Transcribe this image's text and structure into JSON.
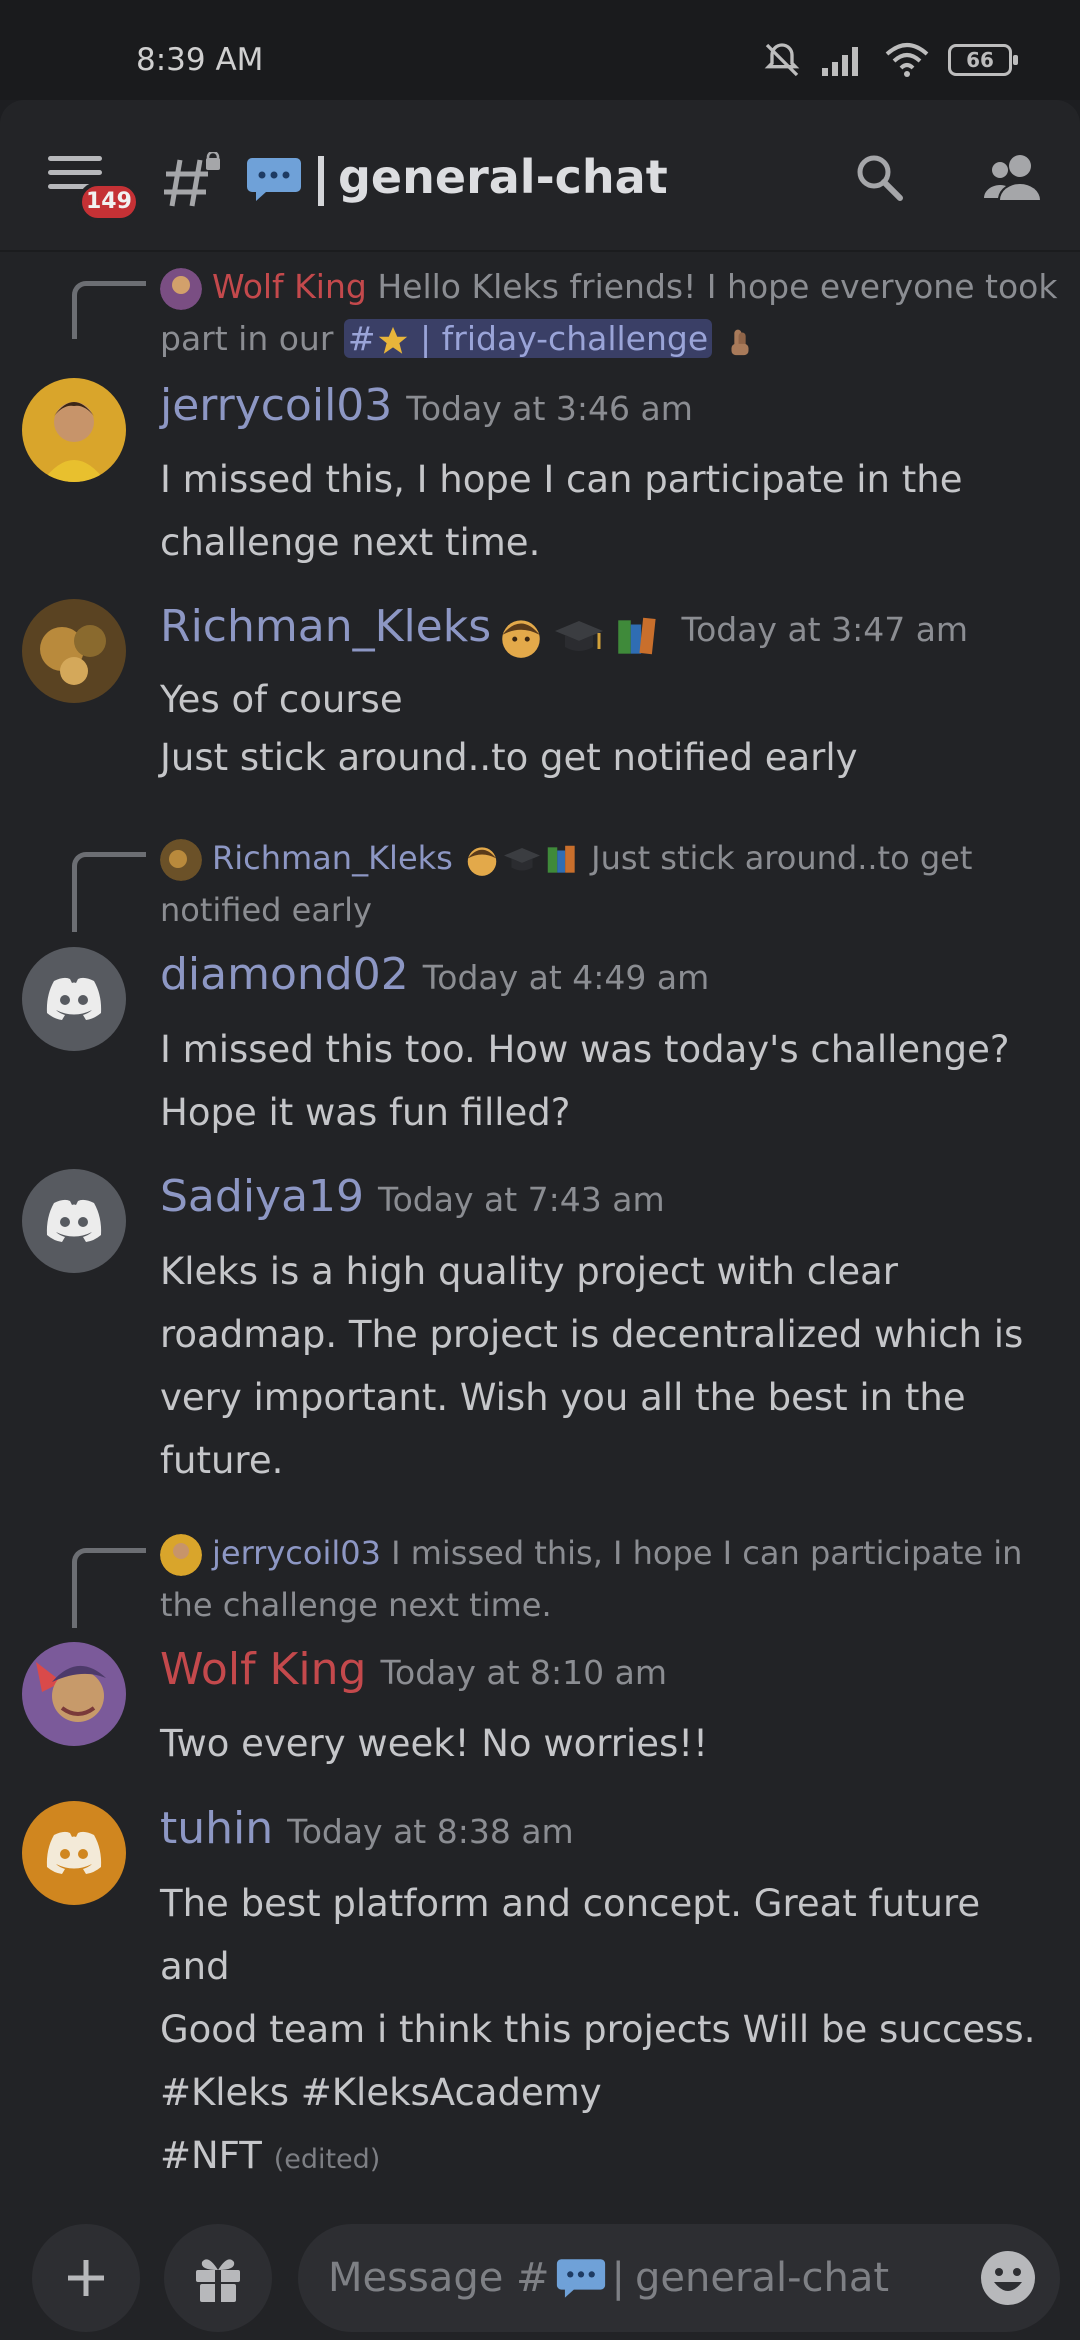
{
  "status_bar": {
    "time": "8:39 AM",
    "battery": "66",
    "icons": [
      "bell-muted-icon",
      "signal-icon",
      "wifi-icon",
      "battery-icon"
    ]
  },
  "header": {
    "badge": "149",
    "channel_name": "general-chat",
    "icons": [
      "menu-icon",
      "hash-lock-icon",
      "speech-balloon-emoji",
      "search-icon",
      "members-icon"
    ]
  },
  "messages": [
    {
      "reply": {
        "name": "Wolf King",
        "text_before": "Hello Kleks friends! I hope everyone took part in our ",
        "mention": "friday-challenge"
      },
      "username": "jerrycoil03",
      "timestamp": "Today at 3:46 am",
      "body": "I missed this, I hope I can participate in the challenge next time."
    },
    {
      "username": "Richman_Kleks",
      "timestamp": "Today at 3:47 am",
      "body_lines": [
        "Yes of course",
        "Just stick around..to get notified early"
      ]
    },
    {
      "reply": {
        "name": "Richman_Kleks",
        "text": "Just stick around..to get notified early"
      },
      "username": "diamond02",
      "timestamp": "Today at 4:49 am",
      "body": "I missed this too. How was today's challenge? Hope it was fun filled?"
    },
    {
      "username": "Sadiya19",
      "timestamp": "Today at 7:43 am",
      "body": "Kleks is a high quality project with clear roadmap. The project is decentralized which is very important. Wish you all the best in the future."
    },
    {
      "reply": {
        "name": "jerrycoil03",
        "text": "I missed this, I hope I can participate in the challenge next time."
      },
      "username": "Wolf King",
      "timestamp": "Today at 8:10 am",
      "body": "Two every week! No worries!!"
    },
    {
      "username": "tuhin",
      "timestamp": "Today at 8:38 am",
      "body_lines": [
        "The best platform and concept. Great future and",
        "Good team i think this projects Will be success.",
        "#Kleks #KleksAcademy",
        "#NFT"
      ],
      "edited": "(edited)"
    }
  ],
  "composer": {
    "placeholder_prefix": "Message #",
    "placeholder_channel": "general-chat",
    "icons": [
      "plus-icon",
      "gift-icon",
      "emoji-icon"
    ]
  },
  "colors": {
    "background": "#222326",
    "username_blue": "#8d97c4",
    "username_red": "#c4494c",
    "badge_red": "#c53135"
  }
}
